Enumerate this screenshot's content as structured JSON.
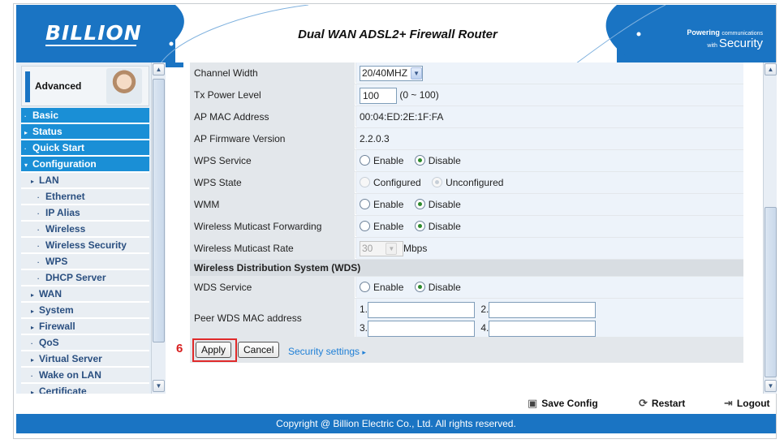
{
  "header": {
    "logo": "BILLION",
    "title": "Dual WAN ADSL2+ Firewall Router",
    "tagline_powering": "Powering",
    "tagline_communications": "communications",
    "tagline_with": "with",
    "tagline_security": "Security"
  },
  "sidebar": {
    "advanced_label": "Advanced",
    "items": [
      {
        "label": "Basic",
        "level": "top",
        "marker": "·"
      },
      {
        "label": "Status",
        "level": "top",
        "marker": "▸"
      },
      {
        "label": "Quick Start",
        "level": "top",
        "marker": "·"
      },
      {
        "label": "Configuration",
        "level": "top",
        "marker": "▾"
      },
      {
        "label": "LAN",
        "level": "l1",
        "marker": "▸"
      },
      {
        "label": "Ethernet",
        "level": "l2",
        "marker": "·"
      },
      {
        "label": "IP Alias",
        "level": "l2",
        "marker": "·"
      },
      {
        "label": "Wireless",
        "level": "l2",
        "marker": "·"
      },
      {
        "label": "Wireless Security",
        "level": "l2",
        "marker": "·"
      },
      {
        "label": "WPS",
        "level": "l2",
        "marker": "·"
      },
      {
        "label": "DHCP Server",
        "level": "l2",
        "marker": "·"
      },
      {
        "label": "WAN",
        "level": "l1",
        "marker": "▸"
      },
      {
        "label": "System",
        "level": "l1",
        "marker": "▸"
      },
      {
        "label": "Firewall",
        "level": "l1",
        "marker": "▸"
      },
      {
        "label": "QoS",
        "level": "l1",
        "marker": "·"
      },
      {
        "label": "Virtual Server",
        "level": "l1",
        "marker": "▸"
      },
      {
        "label": "Wake on LAN",
        "level": "l1",
        "marker": "·"
      },
      {
        "label": "Certificate",
        "level": "l1",
        "marker": "▸"
      }
    ]
  },
  "form": {
    "channel_width": {
      "label": "Channel Width",
      "value": "20/40MHZ"
    },
    "tx_power": {
      "label": "Tx Power Level",
      "value": "100",
      "range": "(0 ~ 100)"
    },
    "ap_mac": {
      "label": "AP MAC Address",
      "value": "00:04:ED:2E:1F:FA"
    },
    "ap_firmware": {
      "label": "AP Firmware Version",
      "value": "2.2.0.3"
    },
    "wps_service": {
      "label": "WPS Service",
      "opt1": "Enable",
      "opt2": "Disable",
      "selected": "Disable"
    },
    "wps_state": {
      "label": "WPS State",
      "opt1": "Configured",
      "opt2": "Unconfigured",
      "selected": "Unconfigured"
    },
    "wmm": {
      "label": "WMM",
      "opt1": "Enable",
      "opt2": "Disable",
      "selected": "Disable"
    },
    "mcast_fwd": {
      "label": "Wireless Muticast Forwarding",
      "opt1": "Enable",
      "opt2": "Disable",
      "selected": "Disable"
    },
    "mcast_rate": {
      "label": "Wireless Muticast Rate",
      "value": "30",
      "unit": "Mbps"
    },
    "wds_section": "Wireless Distribution System (WDS)",
    "wds_service": {
      "label": "WDS Service",
      "opt1": "Enable",
      "opt2": "Disable",
      "selected": "Disable"
    },
    "peer_wds": {
      "label": "Peer WDS MAC address",
      "n1": "1.",
      "n2": "2.",
      "n3": "3.",
      "n4": "4.",
      "v1": "",
      "v2": "",
      "v3": "",
      "v4": ""
    }
  },
  "buttons": {
    "step_number": "6",
    "apply": "Apply",
    "cancel": "Cancel",
    "security_link": "Security settings"
  },
  "actions": {
    "save_config": "Save Config",
    "restart": "Restart",
    "logout": "Logout"
  },
  "footer": {
    "copyright": "Copyright @ Billion Electric Co., Ltd. All rights reserved."
  },
  "colors": {
    "brand_blue": "#1a74c3",
    "menu_blue": "#1a8fd6",
    "highlight_red": "#e02a2a",
    "link_blue": "#1e7fd6"
  }
}
